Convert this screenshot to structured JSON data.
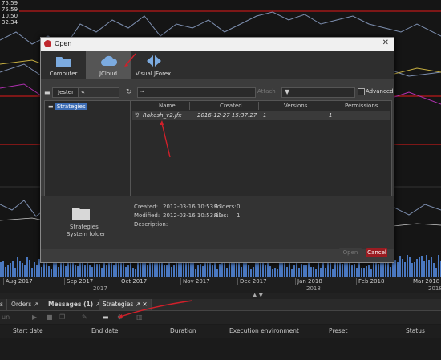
{
  "price_labels": [
    "75.59",
    "75.59",
    "10.50",
    "32.34"
  ],
  "time_axis": {
    "months": [
      "Aug 2017",
      "Sep 2017",
      "Oct 2017",
      "Nov 2017",
      "Dec 2017",
      "Jan 2018",
      "Feb 2018",
      "Mar 2018"
    ],
    "years": [
      "2017",
      "2018",
      "2018"
    ]
  },
  "bottom_tabs": [
    {
      "label": "Orders"
    },
    {
      "label": "Messages (1)"
    },
    {
      "label": "Strategies"
    }
  ],
  "bottom_toolbar": {
    "run_label": "un"
  },
  "results_table": {
    "columns": [
      "Start date",
      "End date",
      "Duration",
      "Execution environment",
      "Preset",
      "Status"
    ]
  },
  "dialog": {
    "title": "Open",
    "sources": [
      {
        "label": "Computer",
        "icon": "folder-icon"
      },
      {
        "label": "JCloud",
        "icon": "cloud-icon"
      },
      {
        "label": "Visual JForex",
        "icon": "visual-jforex-icon"
      }
    ],
    "path": {
      "user": "Jester",
      "back": "«"
    },
    "filter": {
      "value": ""
    },
    "attach_label": "Attach",
    "advanced_label": "Advanced",
    "tree": [
      {
        "label": "Strategies"
      }
    ],
    "file_columns": [
      "Name",
      "Created",
      "Versions",
      "Permissions"
    ],
    "files": [
      {
        "name": "Rakesh_v2.jfx",
        "created": "2016-12-27 15:37:27",
        "versions": "1",
        "permissions": "1"
      }
    ],
    "details": {
      "folder_name": "Strategies",
      "folder_sub": "System folder",
      "created_label": "Created:",
      "created_value": "2012-03-16 10:53:11",
      "modified_label": "Modified:",
      "modified_value": "2012-03-16 10:53:11",
      "description_label": "Description:",
      "folders_label": "Folders:",
      "folders_value": "0",
      "files_label": "Files:",
      "files_value": "1"
    },
    "open_label": "Open",
    "cancel_label": "Cancel"
  },
  "colors": {
    "accent": "#c0272d",
    "selection": "#3d6db5",
    "annotation": "#d0202a"
  }
}
